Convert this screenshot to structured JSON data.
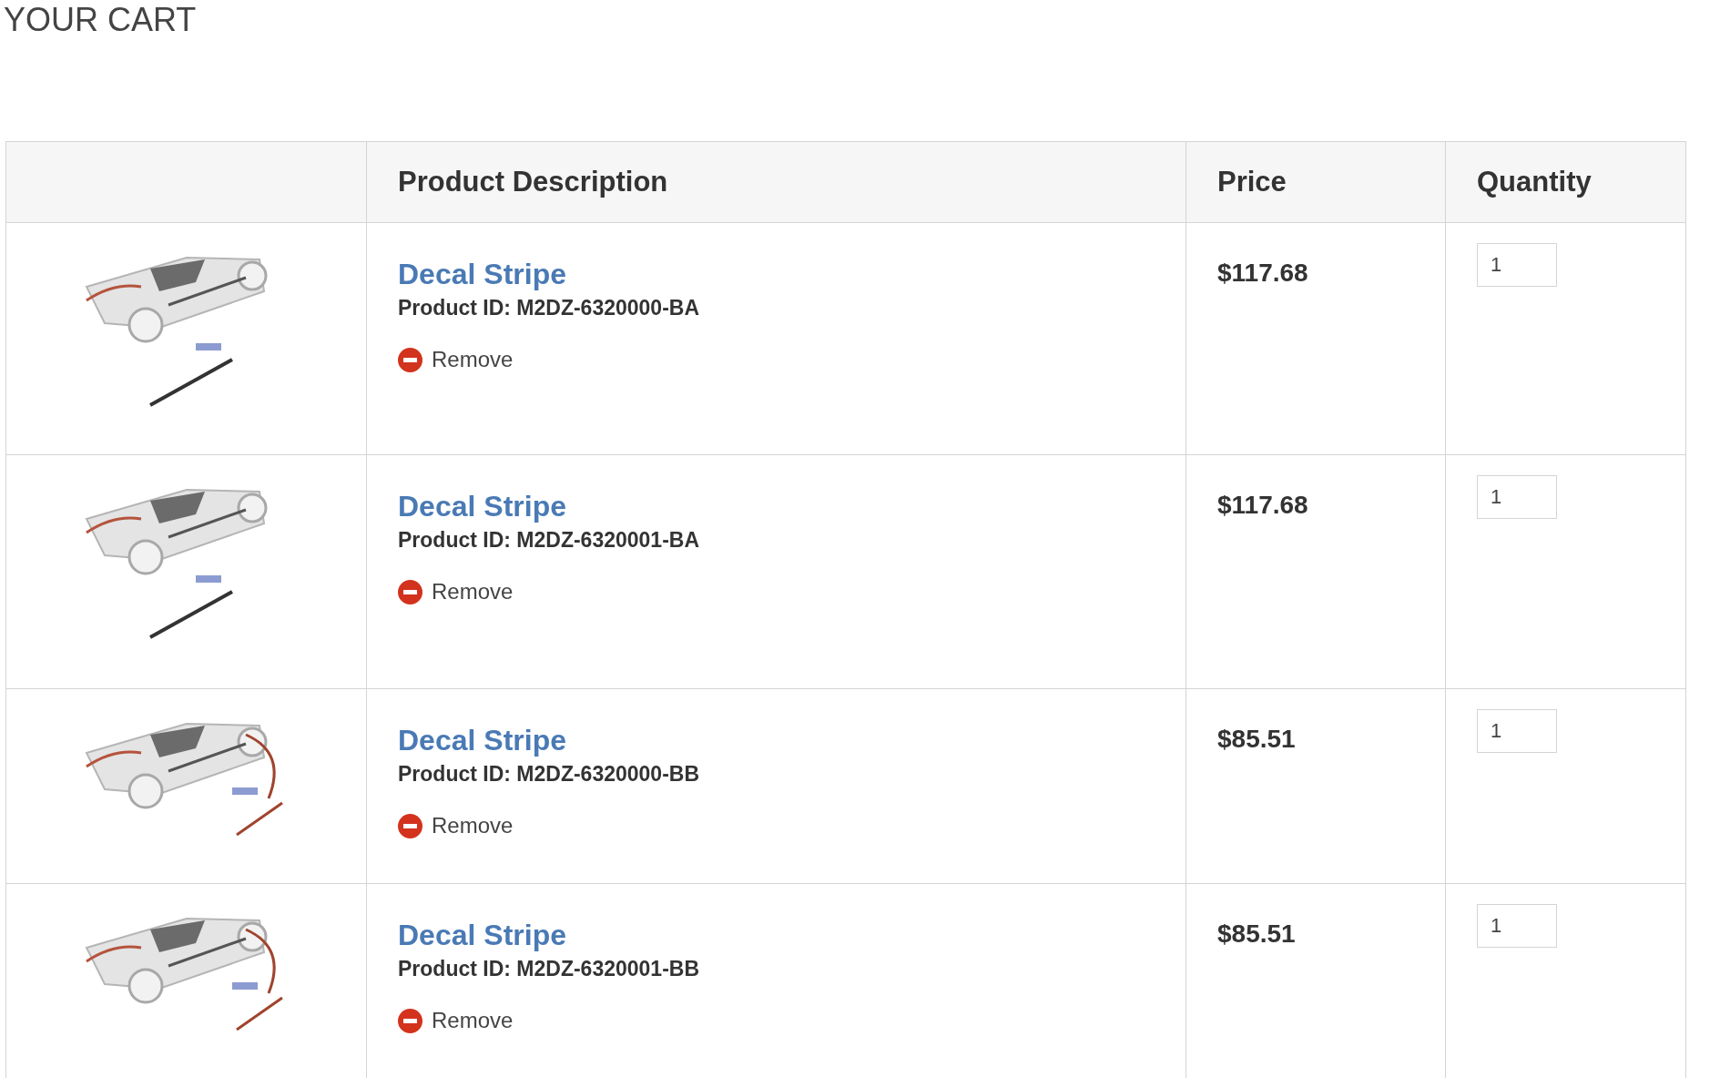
{
  "page_title": "YOUR CART",
  "table": {
    "columns": [
      "Product Description",
      "Price",
      "Quantity"
    ],
    "rows": [
      {
        "name": "Decal Stripe",
        "product_id": "Product ID: M2DZ-6320000-BA",
        "remove": "Remove",
        "price": "$117.68",
        "quantity": "1"
      },
      {
        "name": "Decal Stripe",
        "product_id": "Product ID: M2DZ-6320001-BA",
        "remove": "Remove",
        "price": "$117.68",
        "quantity": "1"
      },
      {
        "name": "Decal Stripe",
        "product_id": "Product ID: M2DZ-6320000-BB",
        "remove": "Remove",
        "price": "$85.51",
        "quantity": "1"
      },
      {
        "name": "Decal Stripe",
        "product_id": "Product ID: M2DZ-6320001-BB",
        "remove": "Remove",
        "price": "$85.51",
        "quantity": "1"
      }
    ]
  }
}
